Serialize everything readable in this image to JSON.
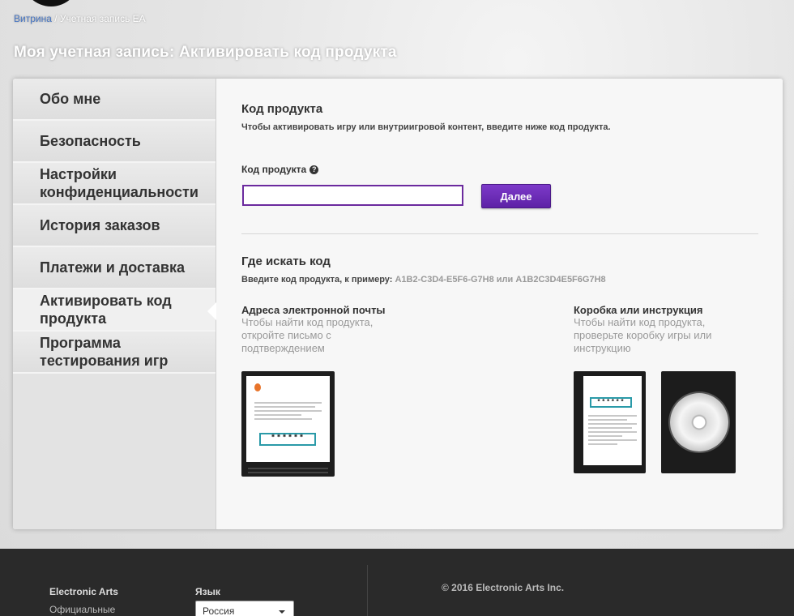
{
  "breadcrumb": {
    "home": "Витрина",
    "separator": "/",
    "current": "Учетная запись EA"
  },
  "page_title": "Моя учетная запись: Активировать код продукта",
  "sidebar": {
    "items": [
      {
        "label": "Обо мне"
      },
      {
        "label": "Безопасность"
      },
      {
        "label": "Настройки конфиденциальности"
      },
      {
        "label": "История заказов"
      },
      {
        "label": "Платежи и доставка"
      },
      {
        "label": "Активировать код продукта"
      },
      {
        "label": "Программа тестирования игр"
      }
    ]
  },
  "product_code": {
    "title": "Код продукта",
    "subtitle": "Чтобы активировать игру или внутриигровой контент, введите ниже код продукта.",
    "field_label": "Код продукта",
    "help_icon": "question-circle-icon",
    "input_value": "",
    "next_button": "Далее"
  },
  "where_to_find": {
    "title": "Где искать код",
    "hint_prefix": "Введите код продукта, к примеру:",
    "hint_example": "A1B2-C3D4-E5F6-G7H8 или A1B2C3D4E5F6G7H8",
    "email": {
      "title": "Адреса электронной почты",
      "desc": "Чтобы найти код продукта, откройте письмо с подтверждением",
      "password_mask": "******"
    },
    "box": {
      "title": "Коробка или инструкция",
      "desc": "Чтобы найти код продукта, проверьте коробку игры или инструкцию",
      "password_mask": "******"
    }
  },
  "footer": {
    "brand": "Electronic Arts",
    "link": "Официальные",
    "language_label": "Язык",
    "language_value": "Россия",
    "copyright": "© 2016 Electronic Arts Inc."
  },
  "colors": {
    "accent": "#6b2a9e",
    "button": "#6a2bb8",
    "link": "#4a78c4",
    "footer_bg": "#2a2a2a"
  }
}
